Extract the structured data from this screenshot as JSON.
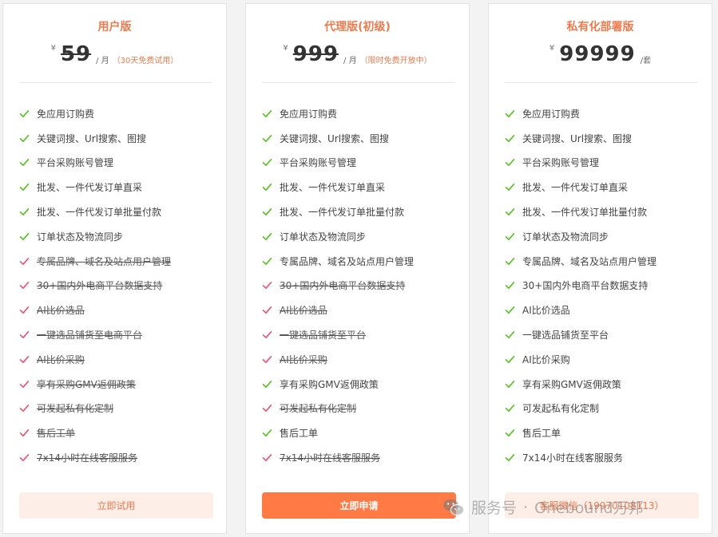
{
  "colors": {
    "accent": "#f07a4d",
    "button_solid": "#ff7a45",
    "button_light": "#fdeee8",
    "included": "#52c41a",
    "excluded": "#f0506e"
  },
  "icons": {
    "included": "check-icon",
    "excluded": "check-icon-crossed-out"
  },
  "plans": [
    {
      "name": "用户版",
      "currency": "¥",
      "price": "59",
      "price_struck": true,
      "unit": "/ 月",
      "promo": "（30天免费试用）",
      "button": "立即试用",
      "button_style": "light",
      "features": [
        {
          "text": "免应用订购费",
          "included": true
        },
        {
          "text": "关键词搜、Url搜索、图搜",
          "included": true
        },
        {
          "text": "平台采购账号管理",
          "included": true
        },
        {
          "text": "批发、一件代发订单直采",
          "included": true
        },
        {
          "text": "批发、一件代发订单批量付款",
          "included": true
        },
        {
          "text": "订单状态及物流同步",
          "included": true
        },
        {
          "text": "专属品牌、域名及站点用户管理",
          "included": false
        },
        {
          "text": "30+国内外电商平台数据支持",
          "included": false
        },
        {
          "text": "AI比价选品",
          "included": false
        },
        {
          "text": "一键选品铺货至电商平台",
          "included": false
        },
        {
          "text": "AI比价采购",
          "included": false
        },
        {
          "text": "享有采购GMV返佣政策",
          "included": false
        },
        {
          "text": "可发起私有化定制",
          "included": false
        },
        {
          "text": "售后工单",
          "included": false
        },
        {
          "text": "7x14小时在线客服服务",
          "included": false
        }
      ]
    },
    {
      "name": "代理版(初级)",
      "currency": "¥",
      "price": "999",
      "price_struck": true,
      "unit": "/ 月",
      "promo": "（限时免费开放中）",
      "button": "立即申请",
      "button_style": "solid",
      "features": [
        {
          "text": "免应用订购费",
          "included": true
        },
        {
          "text": "关键词搜、Url搜索、图搜",
          "included": true
        },
        {
          "text": "平台采购账号管理",
          "included": true
        },
        {
          "text": "批发、一件代发订单直采",
          "included": true
        },
        {
          "text": "批发、一件代发订单批量付款",
          "included": true
        },
        {
          "text": "订单状态及物流同步",
          "included": true
        },
        {
          "text": "专属品牌、域名及站点用户管理",
          "included": true
        },
        {
          "text": "30+国内外电商平台数据支持",
          "included": false
        },
        {
          "text": "AI比价选品",
          "included": false
        },
        {
          "text": "一键选品铺货至平台",
          "included": false
        },
        {
          "text": "AI比价采购",
          "included": false
        },
        {
          "text": "享有采购GMV返佣政策",
          "included": true
        },
        {
          "text": "可发起私有化定制",
          "included": false
        },
        {
          "text": "售后工单",
          "included": true
        },
        {
          "text": "7x14小时在线客服服务",
          "included": false
        }
      ]
    },
    {
      "name": "私有化部署版",
      "currency": "¥",
      "price": "99999",
      "price_struck": false,
      "unit": "/套",
      "promo": "",
      "button": "客服微信（19970108113）",
      "button_style": "light",
      "features": [
        {
          "text": "免应用订购费",
          "included": true
        },
        {
          "text": "关键词搜、Url搜索、图搜",
          "included": true
        },
        {
          "text": "平台采购账号管理",
          "included": true
        },
        {
          "text": "批发、一件代发订单直采",
          "included": true
        },
        {
          "text": "批发、一件代发订单批量付款",
          "included": true
        },
        {
          "text": "订单状态及物流同步",
          "included": true
        },
        {
          "text": "专属品牌、域名及站点用户管理",
          "included": true
        },
        {
          "text": "30+国内外电商平台数据支持",
          "included": true
        },
        {
          "text": "AI比价选品",
          "included": true
        },
        {
          "text": "一键选品铺货至平台",
          "included": true
        },
        {
          "text": "AI比价采购",
          "included": true
        },
        {
          "text": "享有采购GMV返佣政策",
          "included": true
        },
        {
          "text": "可发起私有化定制",
          "included": true
        },
        {
          "text": "售后工单",
          "included": true
        },
        {
          "text": "7x14小时在线客服服务",
          "included": true
        }
      ]
    }
  ],
  "watermark": {
    "icon": "wechat-icon",
    "label": "服务号",
    "separator": "·",
    "name": "Onebound万邦"
  }
}
